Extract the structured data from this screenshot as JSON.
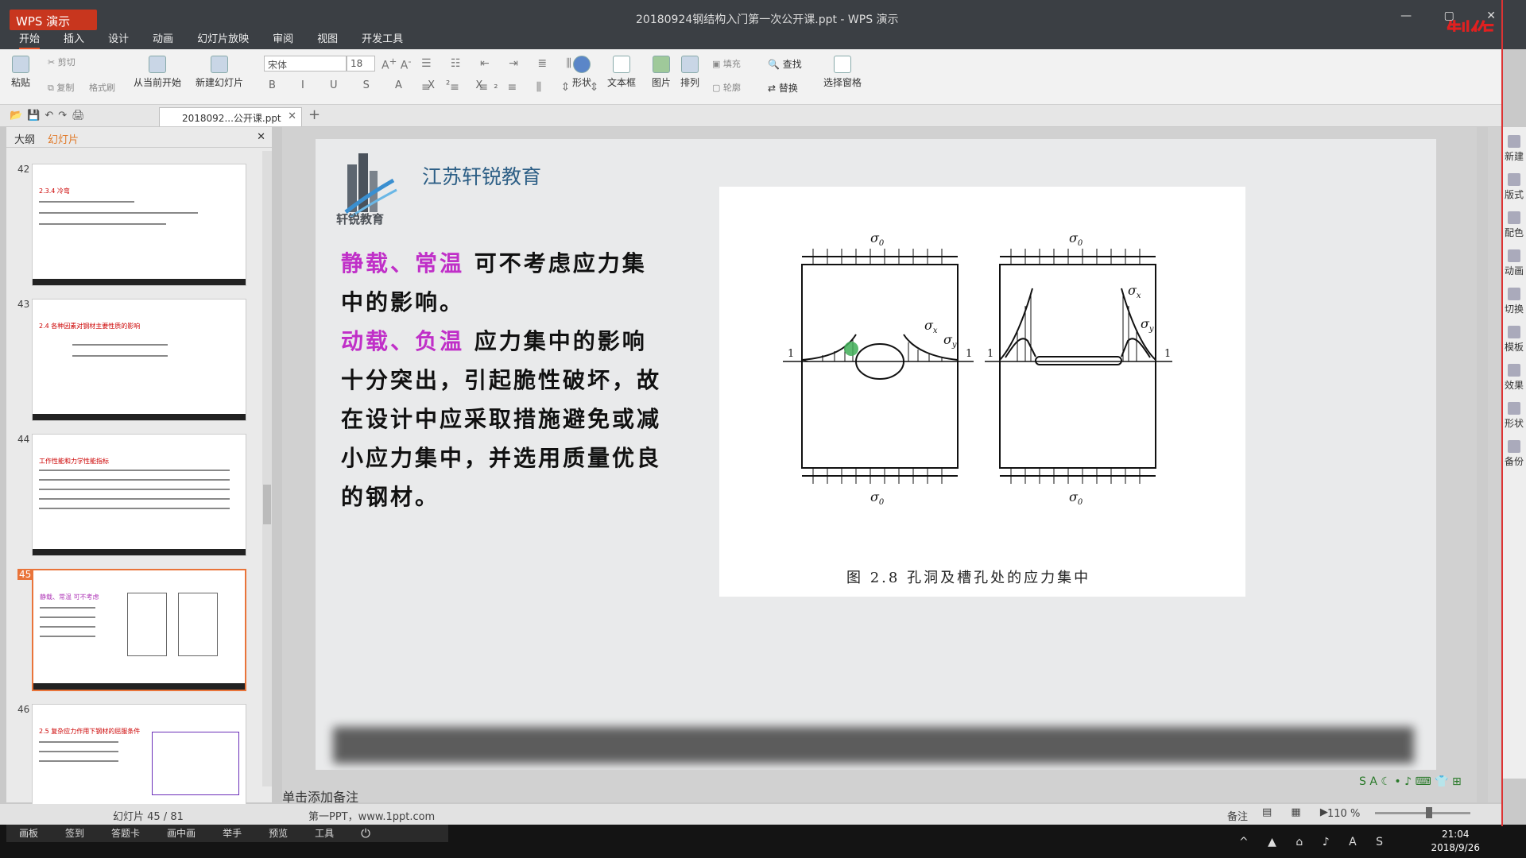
{
  "window": {
    "app_button": "WPS 演示",
    "title": "20180924钢结构入门第一次公开课.ppt - WPS 演示",
    "brand_overlay": "制作"
  },
  "menu": [
    "开始",
    "插入",
    "设计",
    "动画",
    "幻灯片放映",
    "审阅",
    "视图",
    "开发工具"
  ],
  "ribbon": {
    "paste": "粘贴",
    "cut": "剪切",
    "copy": "复制",
    "format_painter": "格式刷",
    "from_current": "从当前开始",
    "new_slide": "新建幻灯片",
    "font": "宋体",
    "font_size": "18",
    "shape": "形状",
    "textbox": "文本框",
    "picture": "图片",
    "arrange": "排列",
    "fill": "填充",
    "outline": "轮廓",
    "find": "查找",
    "replace": "替换",
    "selection_pane": "选择窗格"
  },
  "doc_tab": {
    "label": "2018092...公开课.ppt"
  },
  "sidebar": {
    "tab_outline": "大纲",
    "tab_slides": "幻灯片",
    "thumbs": [
      {
        "num": "42",
        "title": "2.3.4  冷弯"
      },
      {
        "num": "43",
        "title": "2.4  各种因素对钢材主要性质的影响"
      },
      {
        "num": "44",
        "title": "工作性能和力学性能指标"
      },
      {
        "num": "45",
        "title": "静载、常温 可不考虑"
      },
      {
        "num": "46",
        "title": "2.5  复杂应力作用下钢材的屈服条件"
      }
    ],
    "status": "幻灯片 45 / 81"
  },
  "slide": {
    "org_name": "江苏轩锐教育",
    "logo_text": "轩锐教育",
    "hl1": "静载、常温",
    "t1": " 可不考虑应力集中的影响。",
    "hl2": "动载、负温",
    "t2": " 应力集中的影响十分突出，引起脆性破坏，故在设计中应采取措施避免或减小应力集中，并选用质量优良的钢材。",
    "figure_caption": "图 2.8    孔洞及槽孔处的应力集中",
    "fig_labels": {
      "sigma0": "σ",
      "sub0": "0",
      "sx": "x",
      "sy": "y",
      "one": "1"
    }
  },
  "notes_placeholder": "单击添加备注",
  "status": {
    "theme": "第一PPT，www.1ppt.com",
    "notes": "备注",
    "zoom": "110 %"
  },
  "taskbar": {
    "tools": [
      "画板",
      "签到",
      "答题卡",
      "画中画",
      "举手",
      "预览",
      "工具"
    ],
    "time": "21:04",
    "date": "2018/9/26"
  }
}
